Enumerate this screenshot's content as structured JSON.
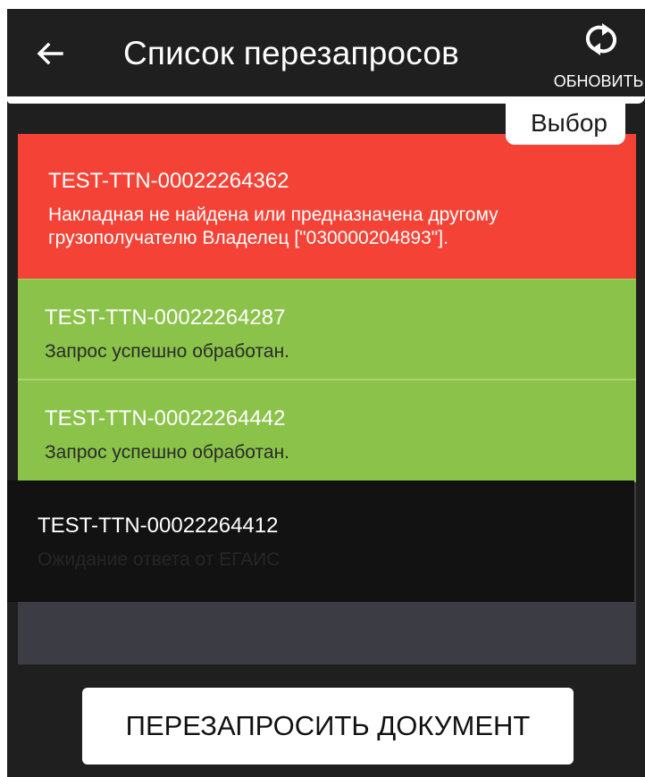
{
  "header": {
    "title": "Список перезапросов",
    "back_icon": "arrow-left-icon",
    "refresh_icon": "refresh-icon",
    "refresh_label": "ОБНОВИТЬ"
  },
  "selection_tab": {
    "label": "Выбор"
  },
  "requests": [
    {
      "document": "TEST-TTN-00022264362",
      "status": "Накладная не найдена или предназначена другому грузополучателю Владелец [\"030000204893\"].",
      "color": "#f44336"
    },
    {
      "document": "TEST-TTN-00022264287",
      "status": "Запрос успешно обработан.",
      "color": "#8bc34a"
    },
    {
      "document": "TEST-TTN-00022264442",
      "status": "Запрос успешно обработан.",
      "color": "#8bc34a"
    },
    {
      "document": "TEST-TTN-00022264412",
      "status": "Ожидание ответа от ЕГАИС",
      "color": "#121212"
    }
  ],
  "footer": {
    "action_label": "ПЕРЕЗАПРОСИТЬ ДОКУМЕНТ"
  },
  "colors": {
    "background": "#1f1f1f",
    "error": "#f44336",
    "success": "#8bc34a",
    "list_background": "#3c3c44"
  }
}
